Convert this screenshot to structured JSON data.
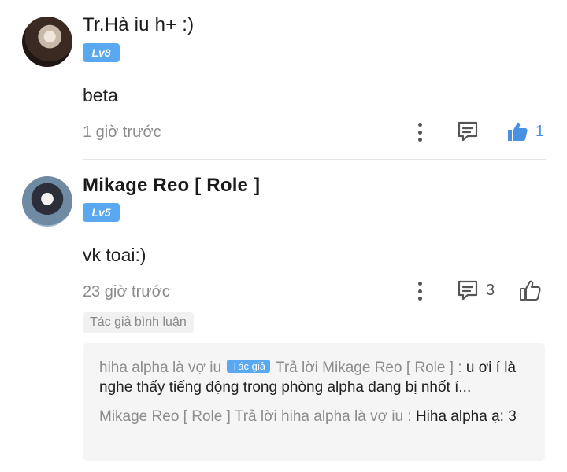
{
  "comments": [
    {
      "user": "Tr.Hà iu h+ :)",
      "level": "Lv8",
      "content": "beta",
      "time": "1 giờ trước",
      "like_count": "1",
      "liked": true
    },
    {
      "user": "Mikage Reo [ Role ]",
      "level": "Lv5",
      "content": "vk toai:)",
      "time": "23 giờ trước",
      "reply_count": "3",
      "liked": false,
      "author_tag": "Tác giả bình luận",
      "replies": [
        {
          "from": "hiha alpha là vợ iu",
          "badge": "Tác giả",
          "reply_prefix": "Trả lời Mikage Reo [ Role ] :",
          "text": "u ơi í là nghe thấy tiếng động trong phòng alpha đang bị nhốt í..."
        },
        {
          "from": "Mikage Reo [ Role ]",
          "reply_prefix": "Trả lời hiha alpha là vợ iu :",
          "text": "Hiha alpha ạ: 3"
        }
      ]
    }
  ],
  "colors": {
    "accent": "#4a90e2",
    "level_badge": "#5aa9f0",
    "muted_text": "#8a8a8a",
    "reply_bg": "#f5f5f5"
  },
  "icons": {
    "more": "more-vertical-icon",
    "reply": "comment-icon",
    "like": "thumbs-up-icon"
  }
}
